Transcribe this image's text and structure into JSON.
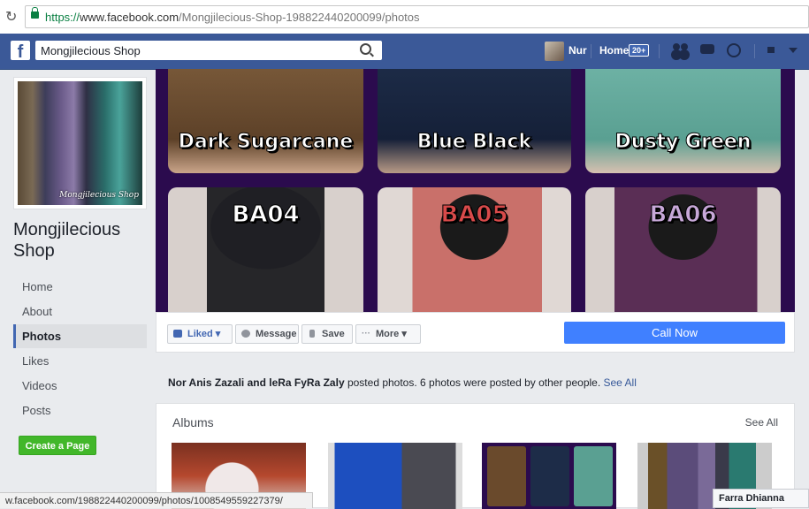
{
  "browser": {
    "url_scheme": "https://",
    "url_domain": "www.facebook.com",
    "url_path": "/Mongjilecious-Shop-198822440200099/photos"
  },
  "topbar": {
    "search_value": "Mongjilecious Shop",
    "user_name": "Nur",
    "home_label": "Home",
    "home_badge": "20+"
  },
  "profile": {
    "picture_caption": "Mongjilecious Shop",
    "page_name": "Mongjilecious Shop"
  },
  "sidebar": {
    "items": [
      {
        "label": "Home",
        "active": false
      },
      {
        "label": "About",
        "active": false
      },
      {
        "label": "Photos",
        "active": true
      },
      {
        "label": "Likes",
        "active": false
      },
      {
        "label": "Videos",
        "active": false
      },
      {
        "label": "Posts",
        "active": false
      }
    ],
    "create_page_label": "Create a Page"
  },
  "cover": {
    "colors": [
      "Dark Sugarcane",
      "Blue Black",
      "Dusty Green"
    ],
    "codes": [
      "BA04",
      "BA05",
      "BA06"
    ]
  },
  "actions": {
    "liked": "Liked",
    "message": "Message",
    "save": "Save",
    "more": "More",
    "call_now": "Call Now"
  },
  "posted": {
    "names": "Nor Anis Zazali and leRa FyRa Zaly",
    "text": " posted photos. 6 photos were posted by other people. ",
    "see_all": "See All"
  },
  "albums": {
    "heading": "Albums",
    "see_all": "See All"
  },
  "status_url": "w.facebook.com/198822440200099/photos/1008549559227379/",
  "chat_name": "Farra Dhianna",
  "colors": {
    "facebook_blue": "#3b5998",
    "call_now": "#4080ff",
    "create_page": "#42b72a",
    "cover_bg": "#2b0b4e"
  }
}
